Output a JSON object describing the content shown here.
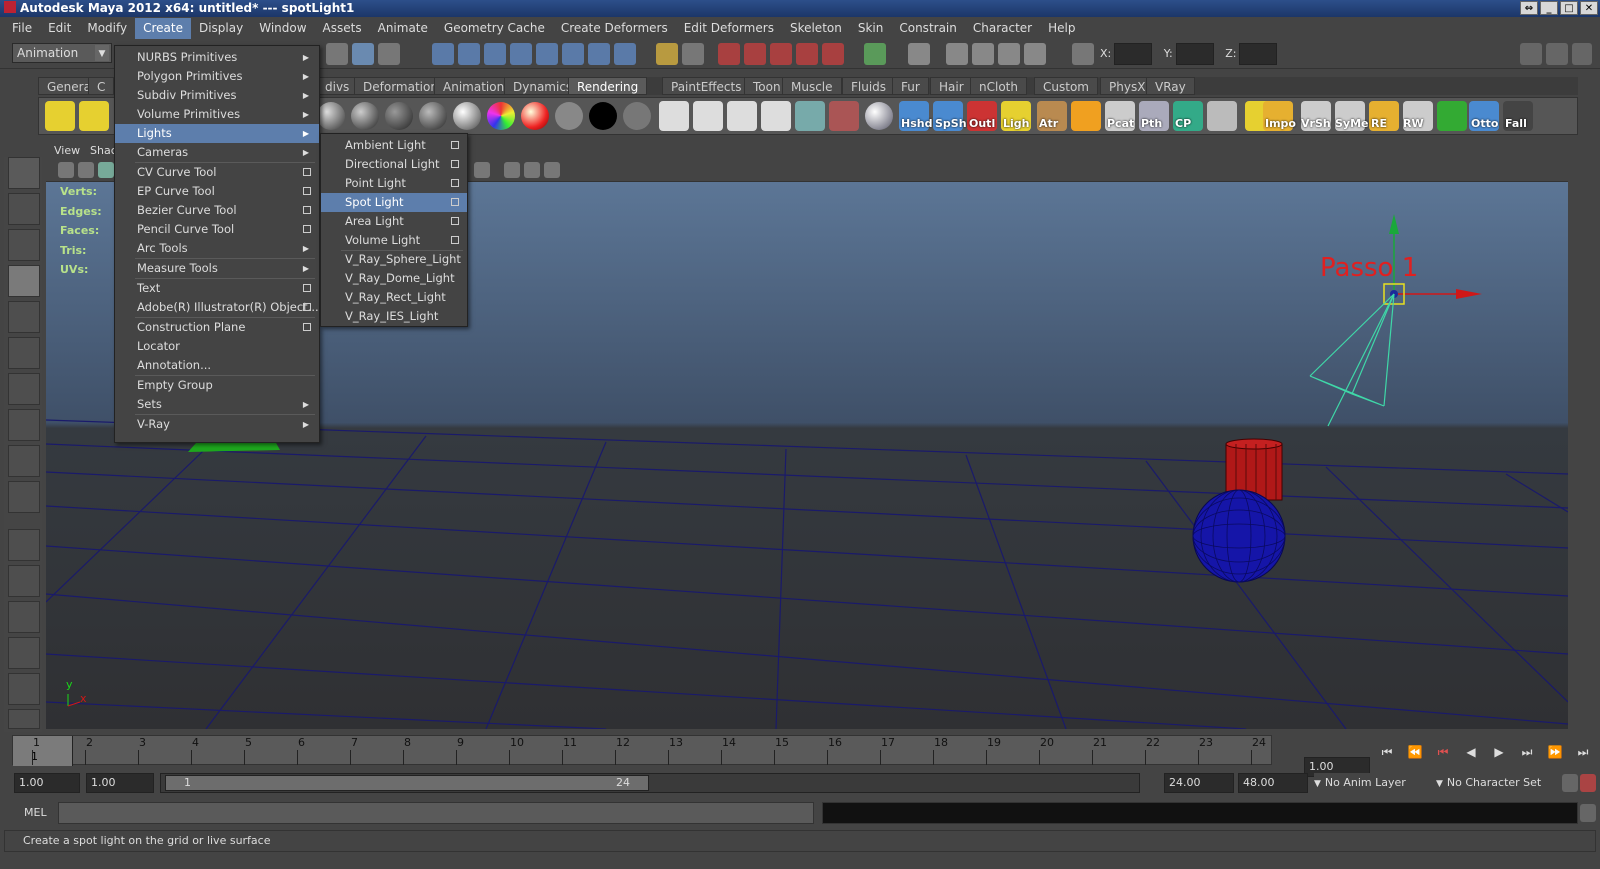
{
  "titlebar": {
    "text": "Autodesk Maya 2012 x64: untitled*   ---   spotLight1"
  },
  "menubar": [
    "File",
    "Edit",
    "Modify",
    "Create",
    "Display",
    "Window",
    "Assets",
    "Animate",
    "Geometry Cache",
    "Create Deformers",
    "Edit Deformers",
    "Skeleton",
    "Skin",
    "Constrain",
    "Character",
    "Help"
  ],
  "mode": "Animation",
  "xyz": {
    "x": "X:",
    "y": "Y:",
    "z": "Z:"
  },
  "shelf_tabs": [
    "General",
    "C",
    "divs",
    "Deformation",
    "Animation",
    "Dynamics",
    "Rendering",
    "PaintEffects",
    "Toon",
    "Muscle",
    "Fluids",
    "Fur",
    "Hair",
    "nCloth",
    "Custom",
    "PhysX",
    "VRay"
  ],
  "shelf_labels": [
    "Hshd",
    "SpSh",
    "Outl",
    "Ligh",
    "Atr",
    "Pcat",
    "Pth",
    "CP",
    "Impo",
    "VrSh",
    "SyMe",
    "RE",
    "RW",
    "Otto",
    "Fall"
  ],
  "view_menu": {
    "view": "View",
    "shading": "Shac"
  },
  "hud": {
    "verts": "Verts:",
    "edges": "Edges:",
    "faces": "Faces:",
    "tris": "Tris:",
    "uvs": "UVs:"
  },
  "create_menu": [
    {
      "label": "NURBS Primitives",
      "type": "sub"
    },
    {
      "label": "Polygon Primitives",
      "type": "sub"
    },
    {
      "label": "Subdiv Primitives",
      "type": "sub"
    },
    {
      "label": "Volume Primitives",
      "type": "sub"
    },
    {
      "label": "Lights",
      "type": "sub"
    },
    {
      "label": "Cameras",
      "type": "sub"
    },
    {
      "label": "CV Curve Tool",
      "type": "opt"
    },
    {
      "label": "EP Curve Tool",
      "type": "opt"
    },
    {
      "label": "Bezier Curve Tool",
      "type": "opt"
    },
    {
      "label": "Pencil Curve Tool",
      "type": "opt"
    },
    {
      "label": "Arc Tools",
      "type": "sub"
    },
    {
      "label": "Measure Tools",
      "type": "sub"
    },
    {
      "label": "Text",
      "type": "opt"
    },
    {
      "label": "Adobe(R) Illustrator(R) Object...",
      "type": "opt"
    },
    {
      "label": "Construction Plane",
      "type": "opt"
    },
    {
      "label": "Locator",
      "type": "none"
    },
    {
      "label": "Annotation...",
      "type": "none"
    },
    {
      "label": "Empty Group",
      "type": "none"
    },
    {
      "label": "Sets",
      "type": "sub"
    },
    {
      "label": "V-Ray",
      "type": "sub"
    }
  ],
  "lights_menu": [
    "Ambient Light",
    "Directional Light",
    "Point Light",
    "Spot Light",
    "Area Light",
    "Volume Light",
    "V_Ray_Sphere_Light",
    "V_Ray_Dome_Light",
    "V_Ray_Rect_Light",
    "V_Ray_IES_Light"
  ],
  "annotation": "Passo 1",
  "axis": {
    "y": "y",
    "x": "x"
  },
  "timeline": {
    "ticks": [
      "1",
      "2",
      "3",
      "4",
      "5",
      "6",
      "7",
      "8",
      "9",
      "10",
      "11",
      "12",
      "13",
      "14",
      "15",
      "16",
      "17",
      "18",
      "19",
      "20",
      "21",
      "22",
      "23",
      "24"
    ],
    "current_frame": "1",
    "current_time": "1.00"
  },
  "range": {
    "start": "1.00",
    "start2": "1.00",
    "slider_start": "1",
    "slider_end": "24",
    "end": "24.00",
    "end2": "48.00",
    "anim_layer": "No Anim Layer",
    "char_set": "No Character Set"
  },
  "mel": {
    "label": "MEL"
  },
  "status": "Create a spot light on the grid or live surface",
  "colors": {
    "highlight": "#5d7eac",
    "menu_bg": "#444444",
    "annotation": "#e02020"
  }
}
